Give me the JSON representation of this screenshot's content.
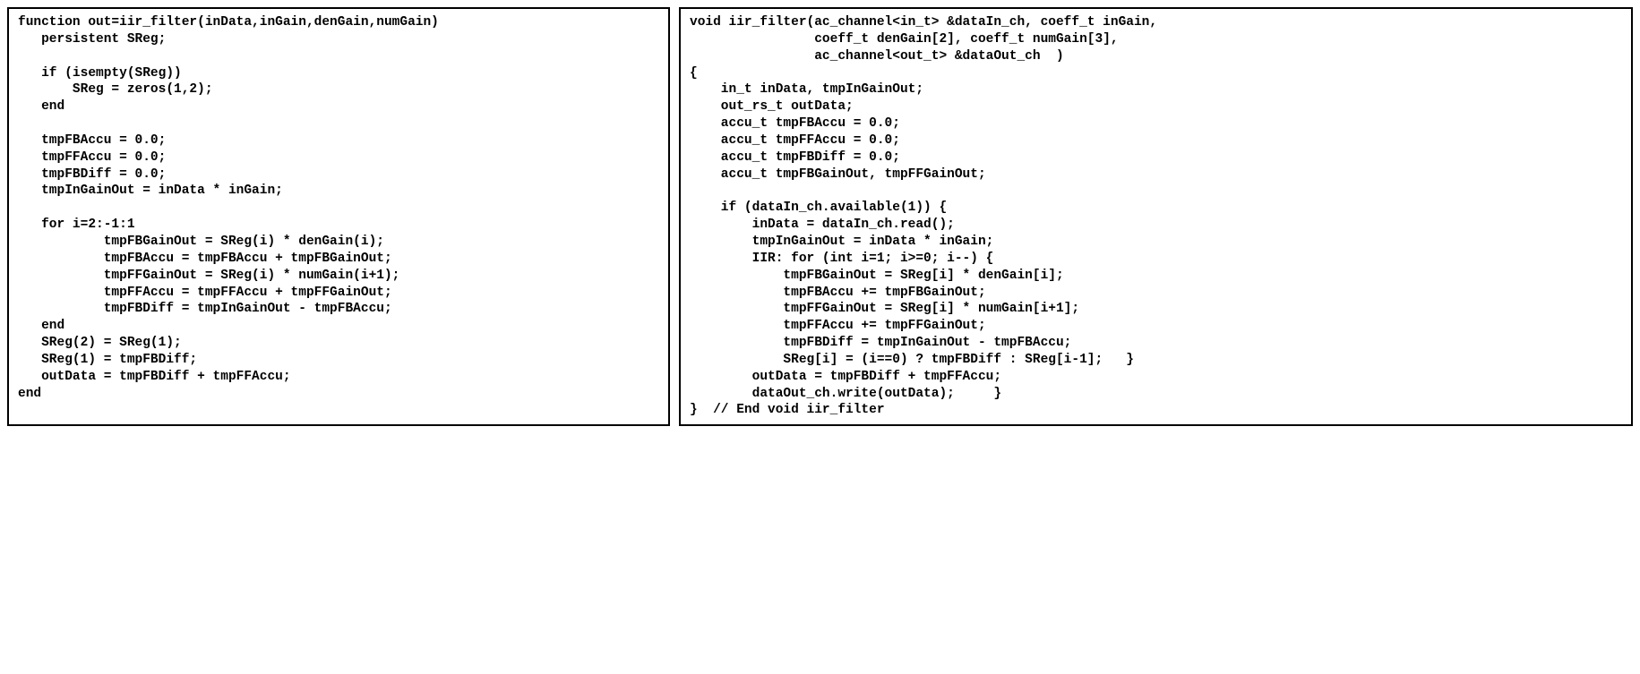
{
  "left": {
    "line1": "function out=iir_filter(inData,inGain,denGain,numGain)",
    "line2": "   persistent SReg;",
    "line3": "",
    "line4": "   if (isempty(SReg))",
    "line5": "       SReg = zeros(1,2);",
    "line6": "   end",
    "line7": "",
    "line8": "   tmpFBAccu = 0.0;",
    "line9": "   tmpFFAccu = 0.0;",
    "line10": "   tmpFBDiff = 0.0;",
    "line11": "   tmpInGainOut = inData * inGain;",
    "line12": "",
    "line13": "   for i=2:-1:1",
    "line14": "           tmpFBGainOut = SReg(i) * denGain(i);",
    "line15": "           tmpFBAccu = tmpFBAccu + tmpFBGainOut;",
    "line16": "           tmpFFGainOut = SReg(i) * numGain(i+1);",
    "line17": "           tmpFFAccu = tmpFFAccu + tmpFFGainOut;",
    "line18": "           tmpFBDiff = tmpInGainOut - tmpFBAccu;",
    "line19": "   end",
    "line20": "   SReg(2) = SReg(1);",
    "line21": "   SReg(1) = tmpFBDiff;",
    "line22": "   outData = tmpFBDiff + tmpFFAccu;",
    "line23": "end"
  },
  "right": {
    "line1": "void iir_filter(ac_channel<in_t> &dataIn_ch, coeff_t inGain,",
    "line2": "                coeff_t denGain[2], coeff_t numGain[3],",
    "line3": "                ac_channel<out_t> &dataOut_ch  )",
    "line4": "{",
    "line5": "    in_t inData, tmpInGainOut;",
    "line6": "    out_rs_t outData;",
    "line7": "    accu_t tmpFBAccu = 0.0;",
    "line8": "    accu_t tmpFFAccu = 0.0;",
    "line9": "    accu_t tmpFBDiff = 0.0;",
    "line10": "    accu_t tmpFBGainOut, tmpFFGainOut;",
    "line11": "",
    "line12": "    if (dataIn_ch.available(1)) {",
    "line13": "        inData = dataIn_ch.read();",
    "line14": "        tmpInGainOut = inData * inGain;",
    "line15": "        IIR: for (int i=1; i>=0; i--) {",
    "line16": "            tmpFBGainOut = SReg[i] * denGain[i];",
    "line17": "            tmpFBAccu += tmpFBGainOut;",
    "line18": "            tmpFFGainOut = SReg[i] * numGain[i+1];",
    "line19": "            tmpFFAccu += tmpFFGainOut;",
    "line20": "            tmpFBDiff = tmpInGainOut - tmpFBAccu;",
    "line21": "            SReg[i] = (i==0) ? tmpFBDiff : SReg[i-1];   }",
    "line22": "        outData = tmpFBDiff + tmpFFAccu;",
    "line23": "        dataOut_ch.write(outData);     }",
    "line24": "}  // End void iir_filter"
  }
}
